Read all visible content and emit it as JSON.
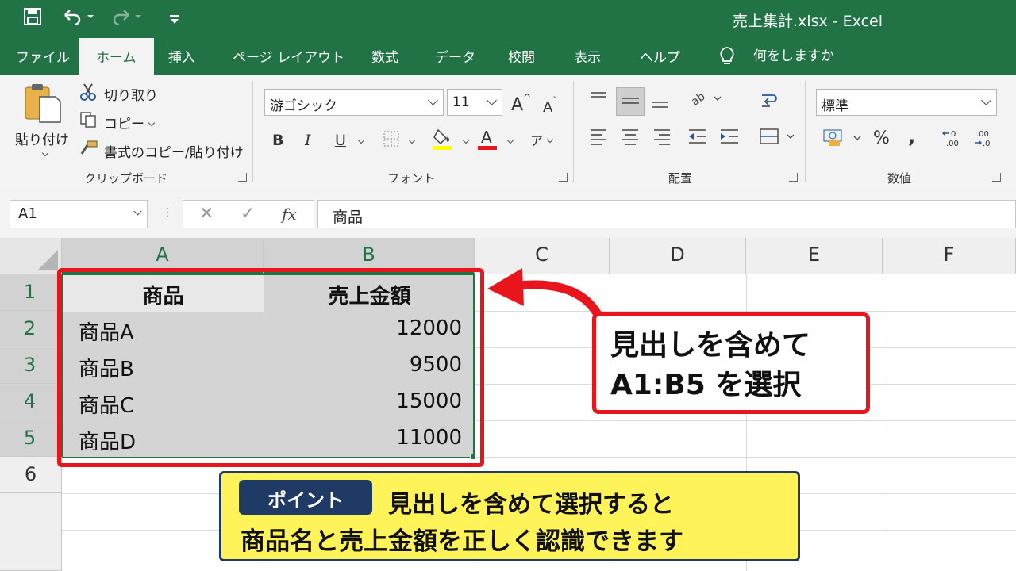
{
  "window": {
    "title": "売上集計.xlsx  -  Excel"
  },
  "menu": {
    "tabs": [
      "ファイル",
      "ホーム",
      "挿入",
      "ページ レイアウト",
      "数式",
      "データ",
      "校閲",
      "表示",
      "ヘルプ"
    ],
    "active": "ホーム",
    "search_text": "何をしますか"
  },
  "ribbon": {
    "clipboard": {
      "paste": "貼り付け",
      "cut": "切り取り",
      "copy": "コピー",
      "format_painter": "書式のコピー/貼り付け",
      "label": "クリップボード"
    },
    "font": {
      "name": "游ゴシック",
      "size": "11",
      "bold": "B",
      "italic": "I",
      "underline": "U",
      "label": "フォント"
    },
    "alignment": {
      "label": "配置"
    },
    "number": {
      "format": "標準",
      "percent": "%",
      "comma": ",",
      "label": "数値"
    }
  },
  "formula_bar": {
    "name_box": "A1",
    "fx": "fx",
    "content": "商品"
  },
  "grid": {
    "columns": [
      "A",
      "B",
      "C",
      "D",
      "E",
      "F"
    ],
    "rows": [
      "1",
      "2",
      "3",
      "4",
      "5",
      "6"
    ],
    "cells": [
      [
        "商品",
        "売上金額"
      ],
      [
        "商品A",
        "12000"
      ],
      [
        "商品B",
        "9500"
      ],
      [
        "商品C",
        "15000"
      ],
      [
        "商品D",
        "11000"
      ]
    ]
  },
  "annotations": {
    "callout_line1": "見出しを含めて",
    "callout_line2": "A1:B5 を選択",
    "tip_badge": "ポイント",
    "tip_line1": "見出しを含めて選択すると",
    "tip_line2": "商品名と売上金額を正しく認識できます"
  },
  "colors": {
    "excel_green": "#217346",
    "highlight_red": "#e8161c",
    "tip_yellow": "#fff35a",
    "tip_navy": "#1f3a64"
  }
}
